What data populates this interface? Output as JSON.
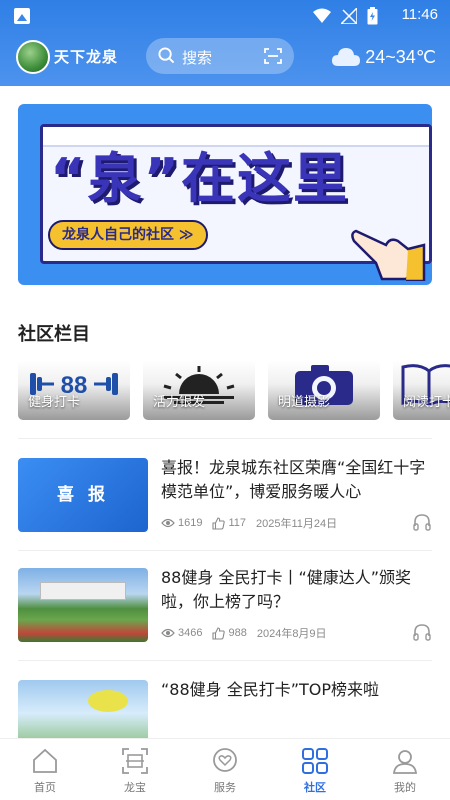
{
  "status_bar": {
    "time": "11:46"
  },
  "header": {
    "app_name": "天下龙泉",
    "search_placeholder": "搜索",
    "weather": "24~34℃"
  },
  "banner": {
    "title": "“泉”在这里",
    "tagline": "龙泉人自己的社区 ≫"
  },
  "section": {
    "title": "社区栏目"
  },
  "categories": [
    {
      "label": "健身打卡",
      "icon": "dumbbell-88-icon"
    },
    {
      "label": "活力银发",
      "icon": "sunrise-icon"
    },
    {
      "label": "明道摄影",
      "icon": "camera-icon"
    },
    {
      "label": "阅读打卡",
      "icon": "book-icon"
    }
  ],
  "news": [
    {
      "title": "喜报！龙泉城东社区荣膺“全国红十字模范单位”，博爱服务暖人心",
      "views": "1619",
      "likes": "117",
      "date": "2025年11月24日",
      "thumb_text": "喜 报"
    },
    {
      "title": "88健身 全民打卡丨“健康达人”颁奖啦，你上榜了吗？",
      "views": "3466",
      "likes": "988",
      "date": "2024年8月9日"
    },
    {
      "title": "“88健身 全民打卡”TOP榜来啦",
      "views": "",
      "likes": "",
      "date": ""
    }
  ],
  "tabs": [
    {
      "label": "首页",
      "icon": "home-icon"
    },
    {
      "label": "龙宝",
      "icon": "scan-frame-icon"
    },
    {
      "label": "服务",
      "icon": "heart-chat-icon"
    },
    {
      "label": "社区",
      "icon": "grid-icon",
      "active": true
    },
    {
      "label": "我的",
      "icon": "profile-icon"
    }
  ],
  "colors": {
    "primary": "#2f7fe6",
    "active_tab": "#2f6fe0"
  }
}
